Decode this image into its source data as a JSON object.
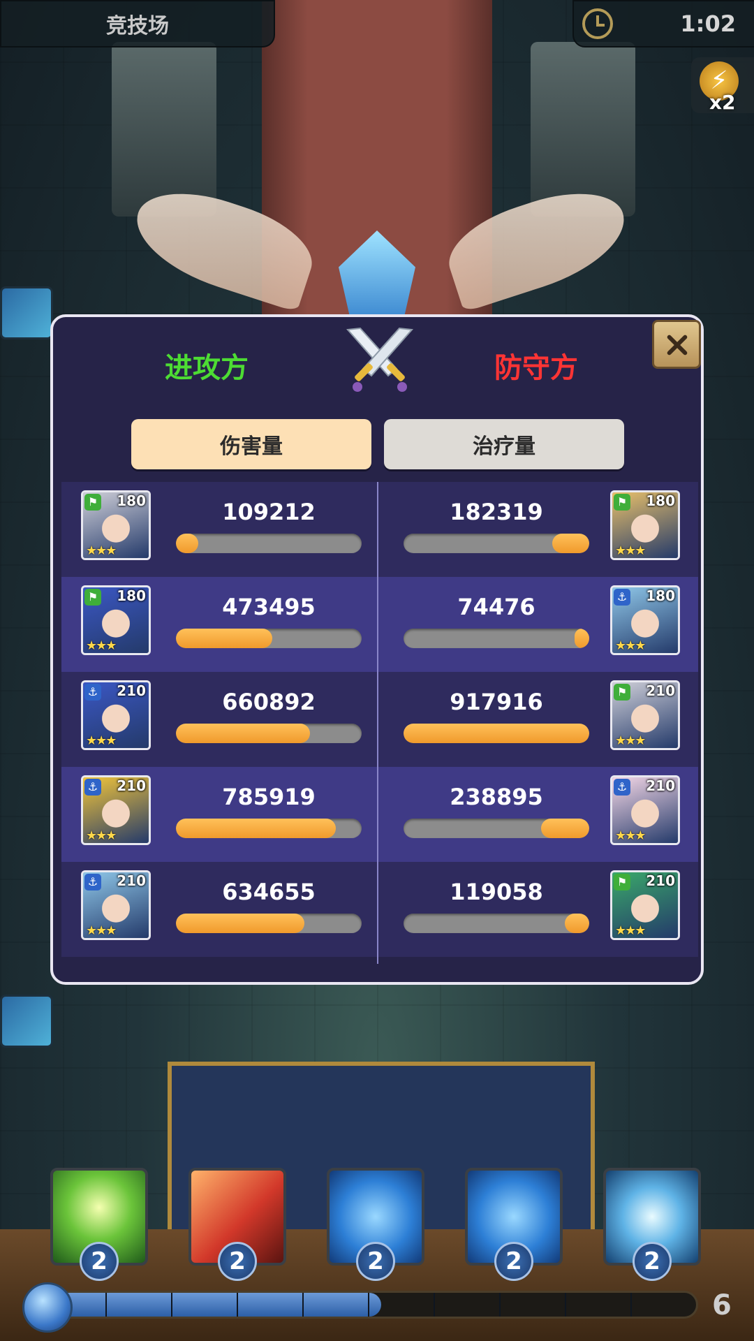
{
  "hud": {
    "mode_title": "竞技场",
    "timer": "1:02",
    "speed_multiplier": "x2"
  },
  "modal": {
    "attacker_label": "进攻方",
    "defender_label": "防守方",
    "tabs": [
      {
        "label": "伤害量",
        "active": true
      },
      {
        "label": "治疗量",
        "active": false
      }
    ],
    "rows": [
      {
        "left": {
          "value": "109212",
          "level": "180",
          "badge": "green",
          "stars": 3,
          "fill": 0.12
        },
        "right": {
          "value": "182319",
          "level": "180",
          "badge": "green",
          "stars": 3,
          "fill": 0.2
        }
      },
      {
        "left": {
          "value": "473495",
          "level": "180",
          "badge": "green",
          "stars": 3,
          "fill": 0.52
        },
        "right": {
          "value": "74476",
          "level": "180",
          "badge": "blue",
          "stars": 3,
          "fill": 0.08
        }
      },
      {
        "left": {
          "value": "660892",
          "level": "210",
          "badge": "blue",
          "stars": 3,
          "fill": 0.72
        },
        "right": {
          "value": "917916",
          "level": "210",
          "badge": "green",
          "stars": 3,
          "fill": 1.0
        }
      },
      {
        "left": {
          "value": "785919",
          "level": "210",
          "badge": "blue",
          "stars": 3,
          "fill": 0.86
        },
        "right": {
          "value": "238895",
          "level": "210",
          "badge": "blue",
          "stars": 3,
          "fill": 0.26
        }
      },
      {
        "left": {
          "value": "634655",
          "level": "210",
          "badge": "blue",
          "stars": 3,
          "fill": 0.69
        },
        "right": {
          "value": "119058",
          "level": "210",
          "badge": "green",
          "stars": 3,
          "fill": 0.13
        }
      }
    ]
  },
  "skills": [
    {
      "count": "2",
      "theme": "green"
    },
    {
      "count": "2",
      "theme": "red"
    },
    {
      "count": "2",
      "theme": "blue"
    },
    {
      "count": "2",
      "theme": "blue"
    },
    {
      "count": "2",
      "theme": "ice"
    }
  ],
  "energy": {
    "value": "6",
    "fill": 0.52
  },
  "colors": {
    "attacker": "#4ddc33",
    "defender": "#ff3434",
    "bar_fill": "#f09a2c",
    "modal_bg": "#262348"
  }
}
